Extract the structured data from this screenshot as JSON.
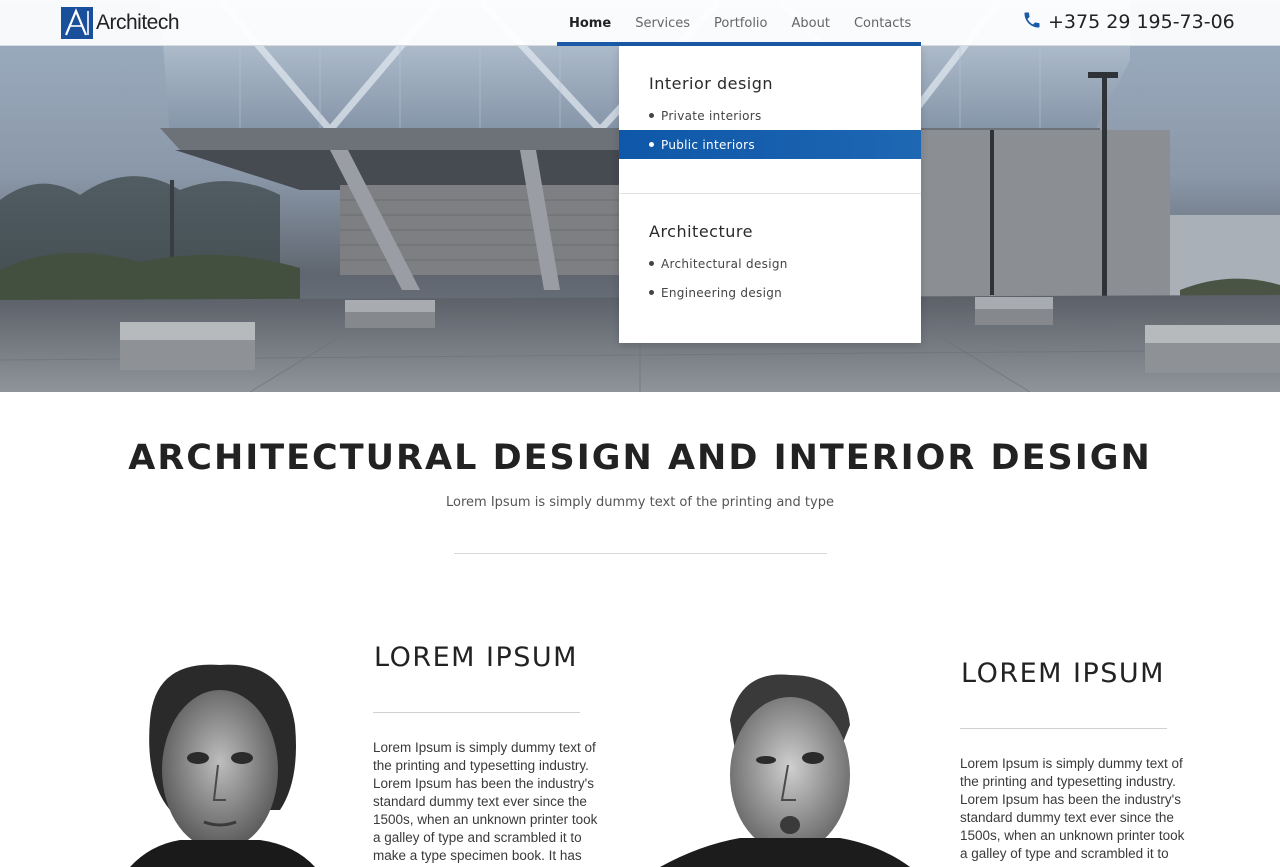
{
  "header": {
    "logo_text": "Architech",
    "nav": [
      {
        "label": "Home"
      },
      {
        "label": "Services"
      },
      {
        "label": "Portfolio"
      },
      {
        "label": "About"
      },
      {
        "label": "Contacts"
      }
    ],
    "phone": "+375 29 195-73-06"
  },
  "dropdown": {
    "groups": [
      {
        "title": "Interior design",
        "items": [
          "Private interiors",
          "Public interiors"
        ]
      },
      {
        "title": "Architecture",
        "items": [
          "Architectural design",
          "Engineering design"
        ]
      }
    ],
    "active_item": "Public interiors"
  },
  "intro": {
    "title": "ARCHITECTURAL DESIGN AND INTERIOR DESIGN",
    "subtitle": "Lorem Ipsum is simply dummy text of the printing and type"
  },
  "profiles": [
    {
      "title": "LOREM IPSUM",
      "lines": [
        "Lorem Ipsum is simply dummy text of",
        "the printing and typesetting industry.",
        "Lorem Ipsum has been the industry's",
        "standard dummy text ever since the",
        "1500s, when an unknown printer took",
        "a galley of type and scrambled it to",
        "make a type specimen book. It has"
      ]
    },
    {
      "title": "LOREM IPSUM",
      "lines": [
        "Lorem Ipsum is simply dummy text of",
        "the printing and typesetting industry.",
        "Lorem Ipsum has been the industry's",
        "standard dummy text ever since the",
        "1500s, when an unknown printer took",
        "a galley of type and scrambled it to"
      ]
    }
  ],
  "colors": {
    "accent": "#1a5aa6",
    "text": "#222222"
  },
  "icons": {
    "phone": "phone-icon",
    "logo": "architech-logo-icon"
  }
}
